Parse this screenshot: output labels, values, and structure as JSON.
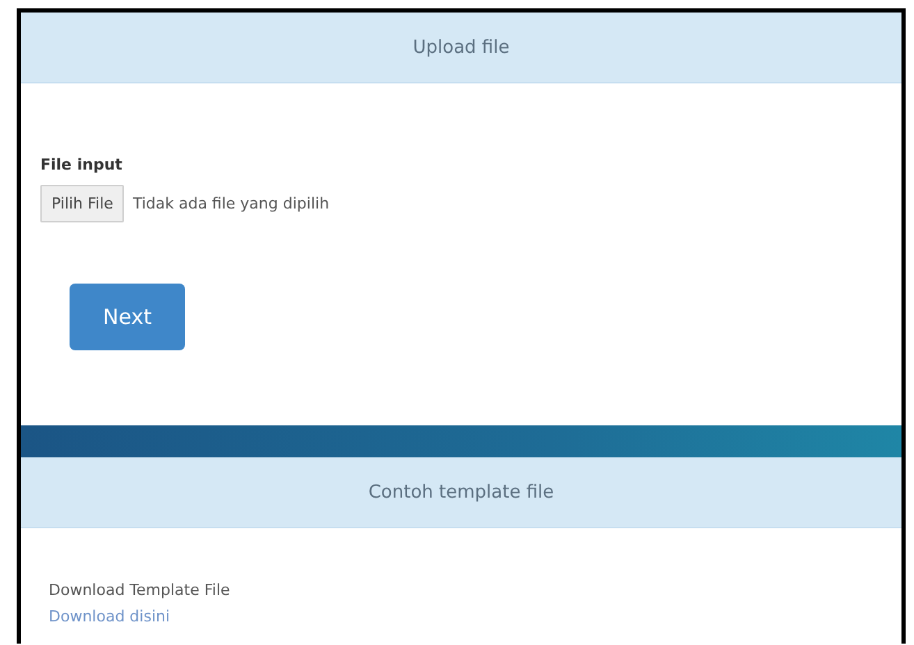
{
  "upload_panel": {
    "title": "Upload file",
    "field_label": "File input",
    "file_button": "Pilih File",
    "file_status": "Tidak ada file yang dipilih",
    "next_button": "Next"
  },
  "template_panel": {
    "title": "Contoh template file",
    "text": "Download Template File",
    "link": "Download disini"
  }
}
